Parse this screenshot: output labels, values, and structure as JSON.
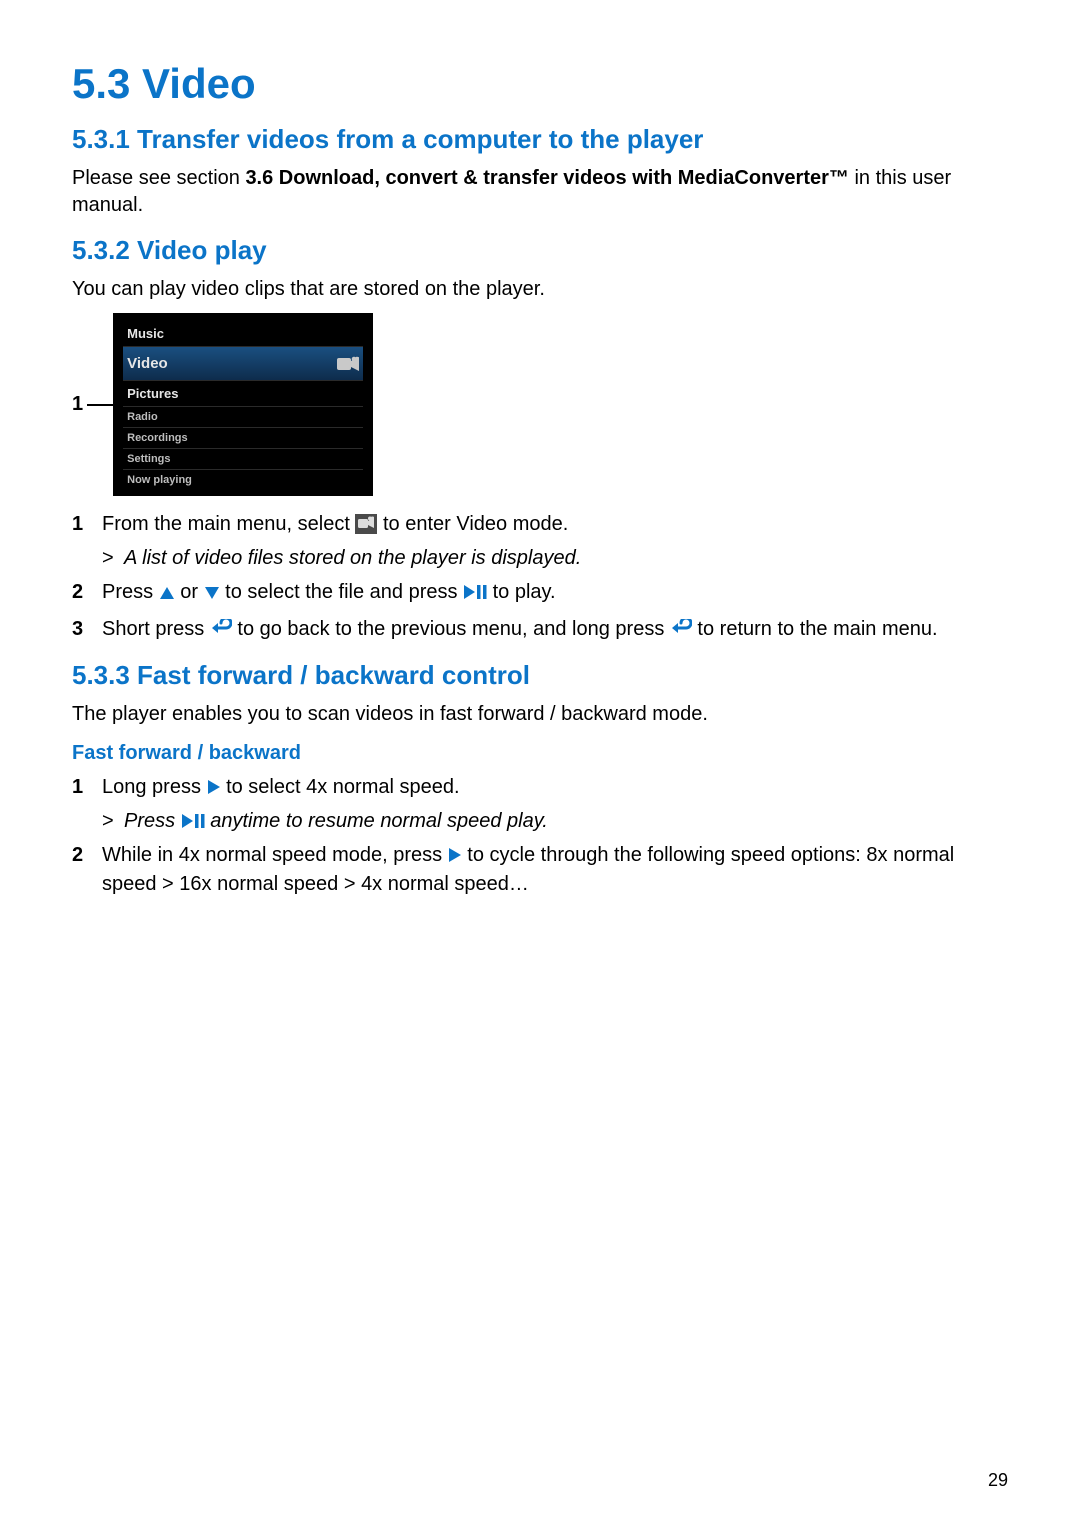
{
  "page_number": "29",
  "headings": {
    "h1": "5.3  Video",
    "h2_transfer": "5.3.1 Transfer videos from a computer to the player",
    "h2_play": "5.3.2 Video play",
    "h2_ff": "5.3.3 Fast forward / backward control",
    "h3_ff": "Fast forward / backward"
  },
  "paragraphs": {
    "transfer_intro_pre": "Please see section ",
    "transfer_intro_bold": "3.6 Download, convert & transfer videos with MediaConverter™",
    "transfer_intro_post": " in this user manual.",
    "play_intro": "You can play video clips that are stored on the player.",
    "ff_intro": "The player enables you to scan videos in fast forward / backward mode."
  },
  "screenshot": {
    "callout": "1",
    "menu": [
      "Music",
      "Video",
      "Pictures",
      "Radio",
      "Recordings",
      "Settings",
      "Now playing"
    ]
  },
  "steps_play": [
    {
      "num": "1",
      "parts": [
        "From the main menu, select ",
        "ICON_VIDEO",
        " to enter Video mode."
      ],
      "sub": "A list of video files stored on the player is displayed."
    },
    {
      "num": "2",
      "parts": [
        "Press ",
        "ICON_UP",
        " or ",
        "ICON_DOWN",
        " to select the file and press ",
        "ICON_PLAYPAUSE",
        " to play."
      ]
    },
    {
      "num": "3",
      "parts": [
        "Short press ",
        "ICON_BACK",
        " to go back to the previous menu, and long press ",
        "ICON_BACK",
        " to return to the main menu."
      ]
    }
  ],
  "steps_ff": [
    {
      "num": "1",
      "parts": [
        "Long press ",
        "ICON_PLAY",
        " to select 4x normal speed."
      ],
      "sub_parts": [
        "Press ",
        "ICON_PLAYPAUSE",
        " anytime to resume normal speed play."
      ]
    },
    {
      "num": "2",
      "parts": [
        "While in 4x normal speed mode, press ",
        "ICON_PLAY",
        " to cycle through the following speed options: 8x normal speed > 16x normal speed > 4x normal speed…"
      ]
    }
  ]
}
